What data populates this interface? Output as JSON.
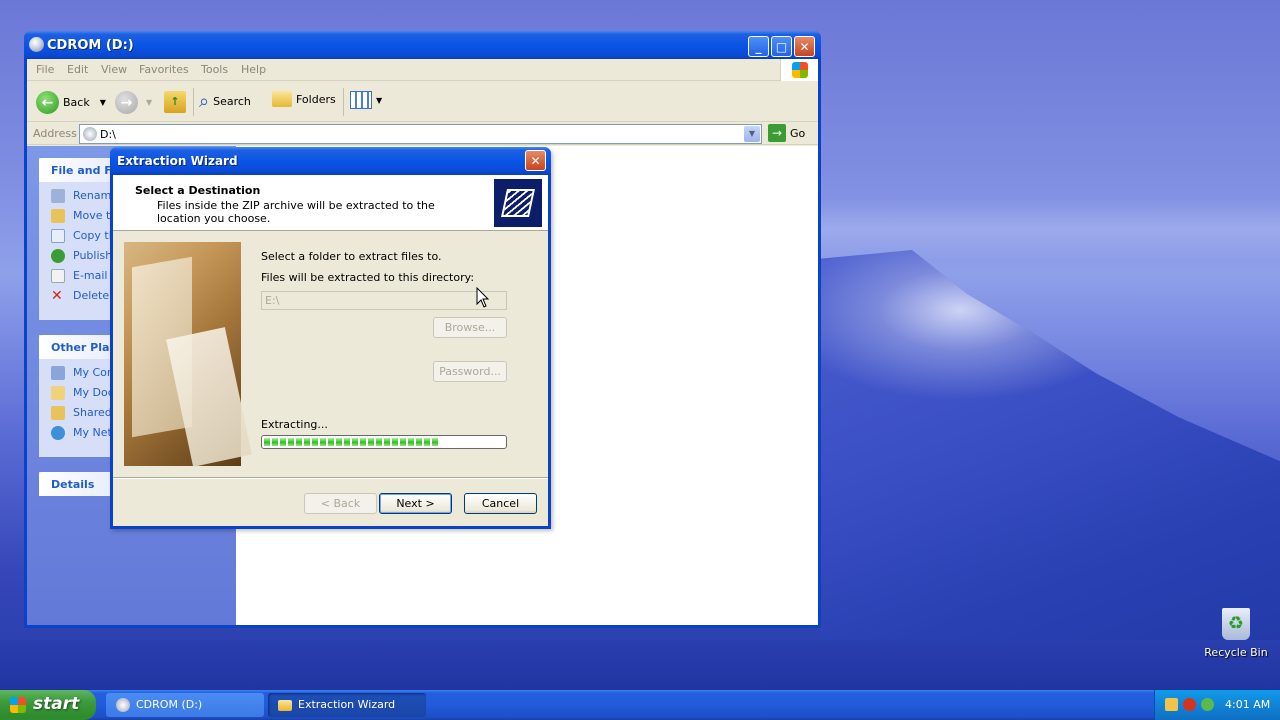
{
  "explorer": {
    "title": "CDROM (D:)",
    "menu": [
      "File",
      "Edit",
      "View",
      "Favorites",
      "Tools",
      "Help"
    ],
    "toolbar": {
      "back": "Back",
      "search": "Search",
      "folders": "Folders"
    },
    "address": {
      "label": "Address",
      "value": "D:\\",
      "go": "Go"
    },
    "file_tasks": {
      "header": "File and Fo",
      "items": [
        "Rename",
        "Move th",
        "Copy th",
        "Publish",
        "E-mail t",
        "Delete t"
      ]
    },
    "other_places": {
      "header": "Other Plac",
      "items": [
        "My Com",
        "My Doc",
        "Shared",
        "My Netw"
      ]
    },
    "details": {
      "header": "Details"
    }
  },
  "wizard": {
    "title": "Extraction Wizard",
    "heading": "Select a Destination",
    "subheading": "Files inside the ZIP archive will be extracted to the location you choose.",
    "instruction": "Select a folder to extract files to.",
    "dir_label": "Files will be extracted to this directory:",
    "dir_value": "E:\\",
    "browse": "Browse...",
    "password": "Password...",
    "status": "Extracting...",
    "progress": 0.74,
    "buttons": {
      "back": "< Back",
      "next": "Next >",
      "cancel": "Cancel"
    }
  },
  "desktop": {
    "recycle_bin": "Recycle Bin"
  },
  "taskbar": {
    "start": "start",
    "tasks": [
      "CDROM (D:)",
      "Extraction Wizard"
    ],
    "clock": "4:01 AM"
  },
  "colors": {
    "titlebar": "#0a55e6",
    "progress": "#2bc21b",
    "task_link": "#215dc6"
  }
}
